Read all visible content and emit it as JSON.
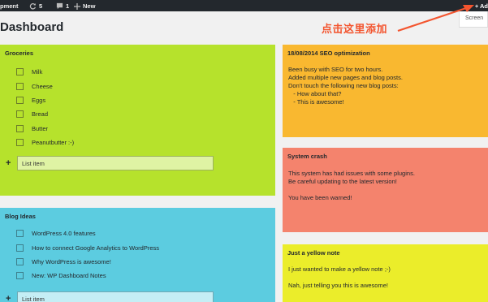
{
  "admin_bar": {
    "site_name": "pment",
    "updates_count": "5",
    "comments_count": "1",
    "new_label": "New",
    "add_label": "+ Ad"
  },
  "screen_options": {
    "label": "Screen"
  },
  "page": {
    "title": "Dashboard"
  },
  "annotation": {
    "text": "点击这里添加",
    "color": "#f3552f"
  },
  "notes": {
    "groceries": {
      "title": "Groceries",
      "color": "#b6e22c",
      "items": [
        "Milk",
        "Cheese",
        "Eggs",
        "Bread",
        "Butter",
        "Peanutbutter :-)"
      ],
      "input_placeholder": "List item"
    },
    "blog_ideas": {
      "title": "Blog Ideas",
      "color": "#5ccce0",
      "items": [
        "WordPress 4.0 features",
        "How to connect Google Analytics to WordPress",
        "Why WordPress is awesome!",
        "New: WP Dashboard Notes"
      ],
      "input_placeholder": "List item"
    },
    "seo": {
      "title": "18/08/2014 SEO optimization",
      "color": "#f9b830",
      "body": "Been busy with SEO for two hours.\nAdded multiple new pages and blog posts.\nDon't touch the following new blog posts:\n   - How about that?\n   - This is awesome!"
    },
    "crash": {
      "title": "System crash",
      "color": "#f4836d",
      "body": "This system has had issues with some plugins.\nBe careful updating to the latest version!\n\nYou have been warned!"
    },
    "yellow": {
      "title": "Just a yellow note",
      "color": "#ebed2a",
      "body": "I just wanted to make a yellow note ;-)\n\nNah, just telling you this is awesome!"
    }
  }
}
